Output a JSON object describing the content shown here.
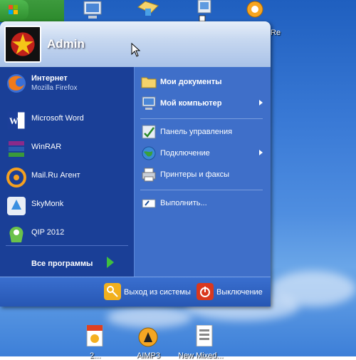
{
  "desktop": {
    "labels": [
      "Re",
      "2...",
      "AIMP3",
      "New Mixed..."
    ]
  },
  "start_menu": {
    "username": "Admin",
    "pinned": [
      {
        "title": "Интернет",
        "subtitle": "Mozilla Firefox"
      }
    ],
    "recent": [
      {
        "title": "Microsoft Word"
      },
      {
        "title": "WinRAR"
      },
      {
        "title": "Mail.Ru Агент"
      },
      {
        "title": "SkyMonk"
      },
      {
        "title": "QIP 2012"
      }
    ],
    "all_programs": "Все программы",
    "right": [
      {
        "label": "Мои документы",
        "bold": true
      },
      {
        "label": "Мой компьютер",
        "bold": true
      },
      {
        "label": "Панель управления"
      },
      {
        "label": "Подключение"
      },
      {
        "label": "Принтеры и факсы"
      },
      {
        "label": "Выполнить..."
      }
    ],
    "footer": {
      "logoff": "Выход из системы",
      "shutdown": "Выключение"
    }
  },
  "colors": {
    "accent_green": "#3fbf3f",
    "menu_left": "#1a3f97",
    "menu_right": "#3f6fc9"
  }
}
